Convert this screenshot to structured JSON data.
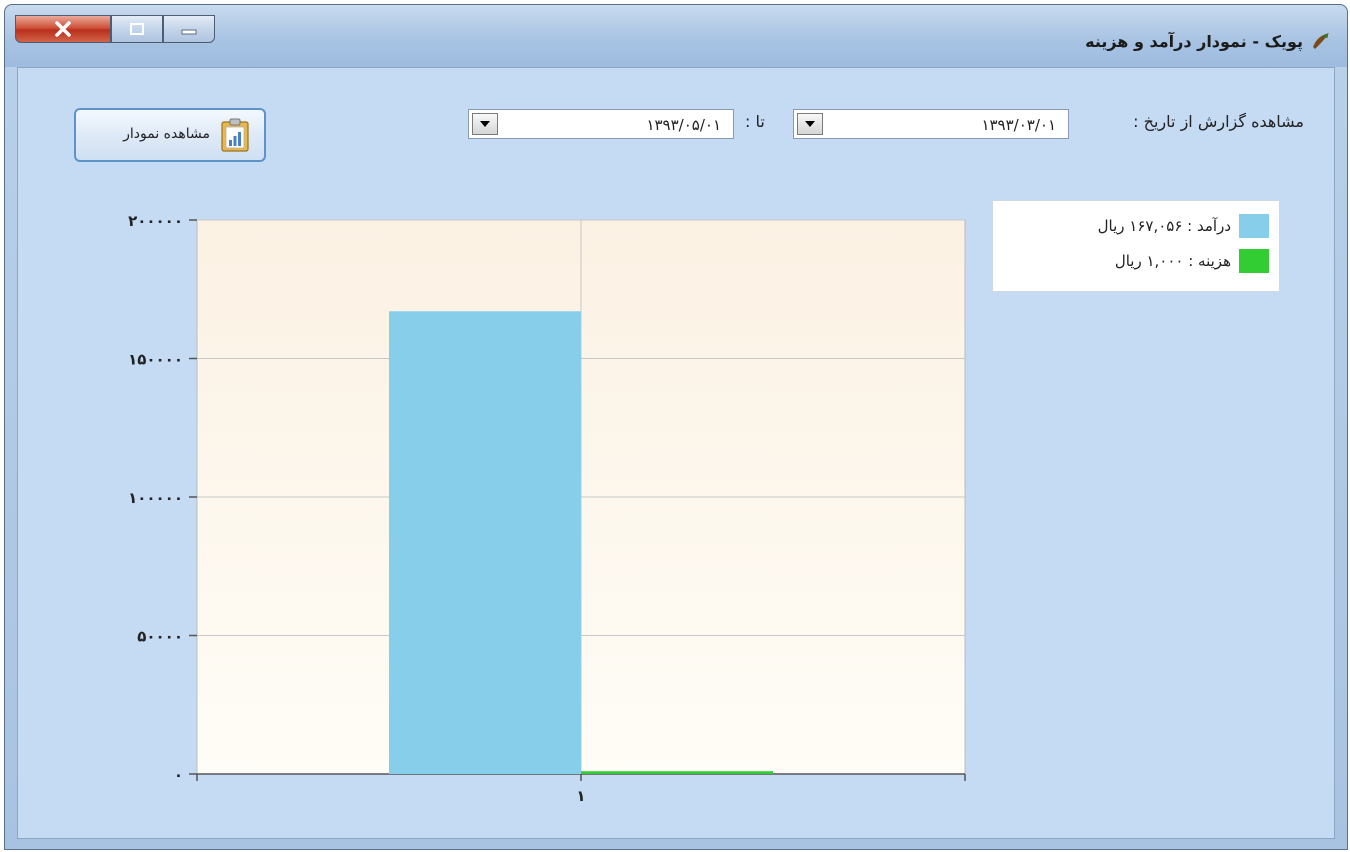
{
  "window": {
    "title": "پویک - نمودار درآمد و هزینه"
  },
  "filters": {
    "from_label": "مشاهده گزارش از تاریخ :",
    "from_date": "۱۳۹۳/۰۳/۰۱",
    "to_label": "تا :",
    "to_date": "۱۳۹۳/۰۵/۰۱",
    "view_button_label": "مشاهده نمودار"
  },
  "legend": {
    "items": [
      {
        "label": "درآمد : ۱۶۷,۰۵۶ ریال",
        "color": "#87ceeb"
      },
      {
        "label": "هزینه : ۱,۰۰۰ ریال",
        "color": "#32cd32"
      }
    ]
  },
  "chart_data": {
    "type": "bar",
    "categories": [
      "۱"
    ],
    "series": [
      {
        "name": "درآمد",
        "values": [
          167056
        ],
        "color": "#87ceeb"
      },
      {
        "name": "هزینه",
        "values": [
          1000
        ],
        "color": "#32cd32"
      }
    ],
    "ylim": [
      0,
      200000
    ],
    "yticks": [
      0,
      50000,
      100000,
      150000,
      200000
    ],
    "ytick_labels": [
      "۰",
      "۵۰۰۰۰",
      "۱۰۰۰۰۰",
      "۱۵۰۰۰۰",
      "۲۰۰۰۰۰"
    ],
    "grid": true
  }
}
